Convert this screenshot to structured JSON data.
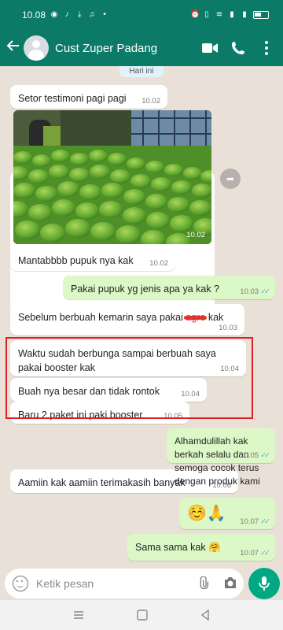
{
  "status_bar": {
    "time": "10.08"
  },
  "header": {
    "contact_name": "Cust Zuper Padang"
  },
  "chat": {
    "day_label": "Hari ini",
    "messages": [
      {
        "dir": "in",
        "text": "Setor testimoni pagi pagi",
        "time": "10.02"
      },
      {
        "dir": "in",
        "type": "photo",
        "time": "10.02"
      },
      {
        "dir": "in",
        "text": "Mantabbbb pupuk nya kak",
        "time": "10.02"
      },
      {
        "dir": "out",
        "text": "Pakai pupuk yg jenis apa ya kak ?",
        "time": "10.03"
      },
      {
        "dir": "in",
        "text_before": "Sebelum berbuah kemarin saya pakai",
        "text_struck": "agro",
        "text_after": "kak",
        "time": "10.03"
      },
      {
        "dir": "in",
        "text": "Waktu sudah berbunga sampai  berbuah  saya pakai booster kak",
        "time": "10.04"
      },
      {
        "dir": "in",
        "text": "Buah nya besar dan tidak rontok",
        "time": "10.04"
      },
      {
        "dir": "in",
        "text": "Baru 2 paket ini paki booster",
        "time": "10.05"
      },
      {
        "dir": "out",
        "text": "Alhamdulillah kak berkah selalu dan semoga cocok terus dengan produk kami",
        "time": "10.05"
      },
      {
        "dir": "in",
        "text": "Aamiin kak aamiin  terimakasih banyak",
        "time": "10.06"
      },
      {
        "dir": "out",
        "text": "☺️🙏",
        "time": "10.07"
      },
      {
        "dir": "out",
        "text": "Sama sama kak 🤗",
        "time": "10.07"
      }
    ],
    "read_ticks": "✓✓"
  },
  "composer": {
    "placeholder": "Ketik pesan"
  },
  "colors": {
    "header": "#0b7a66",
    "outgoing": "#dcf8c6",
    "incoming": "#ffffff",
    "accent": "#00a884",
    "highlight": "#e02020"
  }
}
